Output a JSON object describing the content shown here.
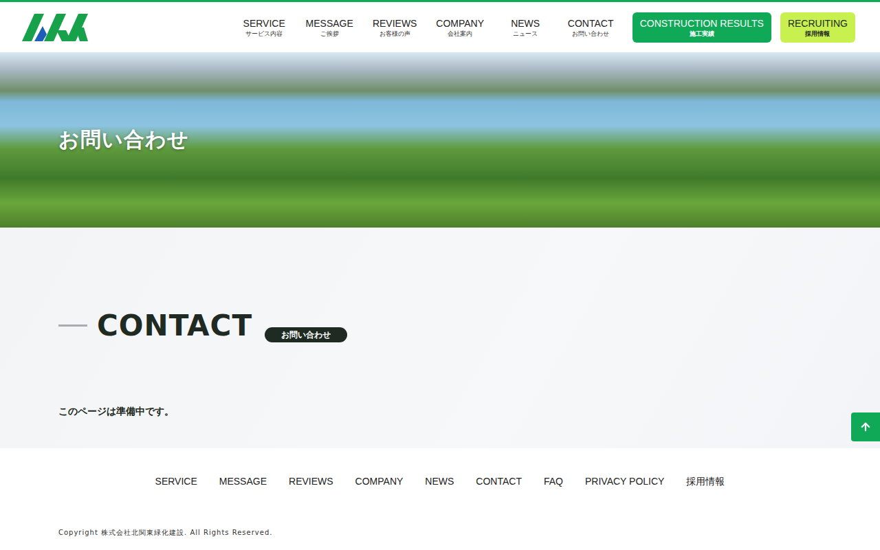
{
  "header": {
    "nav": [
      {
        "label": "SERVICE",
        "sub": "サービス内容"
      },
      {
        "label": "MESSAGE",
        "sub": "ご挨拶"
      },
      {
        "label": "REVIEWS",
        "sub": "お客様の声"
      },
      {
        "label": "COMPANY",
        "sub": "会社案内"
      },
      {
        "label": "NEWS",
        "sub": "ニュース"
      },
      {
        "label": "CONTACT",
        "sub": "お問い合わせ"
      }
    ],
    "buttons": [
      {
        "label": "CONSTRUCTION RESULTS",
        "sub": "施工実績",
        "kind": "primary",
        "color": "#10a957"
      },
      {
        "label": "RECRUITING",
        "sub": "採用情報",
        "kind": "accent",
        "color": "#c8f04f"
      }
    ]
  },
  "hero": {
    "title": "お問い合わせ"
  },
  "section": {
    "heading": "CONTACT",
    "badge": "お問い合わせ",
    "message": "このページは準備中です。"
  },
  "footer": {
    "links": [
      "SERVICE",
      "MESSAGE",
      "REVIEWS",
      "COMPANY",
      "NEWS",
      "CONTACT",
      "FAQ",
      "PRIVACY POLICY",
      "採用情報"
    ],
    "copyright": "Copyright 株式会社北関東緑化建設. All Rights Reserved."
  }
}
